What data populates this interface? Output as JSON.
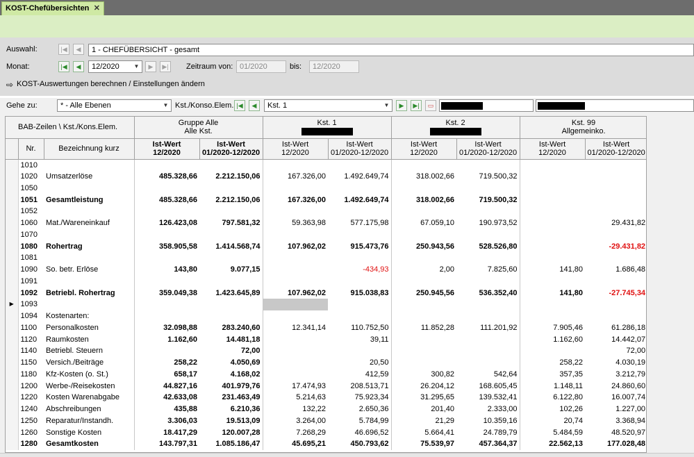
{
  "tab": {
    "title": "KOST-Chefübersichten",
    "close": "✕"
  },
  "auswahl": {
    "label": "Auswahl:",
    "value": "1 - CHEFÜBERSICHT - gesamt"
  },
  "monat": {
    "label": "Monat:",
    "value": "12/2020",
    "zeitraum_label": "Zeitraum von:",
    "from": "01/2020",
    "bis_label": "bis:",
    "to": "12/2020"
  },
  "calc_link": "KOST-Auswertungen berechnen / Einstellungen ändern",
  "goto": {
    "label": "Gehe zu:",
    "value": "* - Alle Ebenen",
    "kst_label": "Kst./Konso.Elem.:",
    "kst_value": "Kst. 1"
  },
  "colors": {
    "accent_green": "#cfe9a4",
    "negative": "#e01010"
  },
  "header": {
    "corner": "BAB-Zeilen  \\  Kst./Kons.Elem.",
    "nr": "Nr.",
    "bez": "Bezeichnung kurz",
    "groups": [
      {
        "line1": "Gruppe Alle",
        "line2": "Alle Kst."
      },
      {
        "line1": "Kst. 1",
        "line2": ""
      },
      {
        "line1": "Kst. 2",
        "line2": ""
      },
      {
        "line1": "Kst. 99",
        "line2": "Allgemeinko."
      }
    ],
    "sub1a": "Ist-Wert",
    "sub1b": "12/2020",
    "sub2a": "Ist-Wert",
    "sub2b": "01/2020-12/2020"
  },
  "rows": [
    {
      "nr": "1010",
      "bez": "",
      "b": false,
      "v": [
        "",
        "",
        "",
        "",
        "",
        "",
        "",
        ""
      ]
    },
    {
      "nr": "1020",
      "bez": "Umsatzerlöse",
      "b": false,
      "v": [
        "485.328,66",
        "2.212.150,06",
        "167.326,00",
        "1.492.649,74",
        "318.002,66",
        "719.500,32",
        "",
        ""
      ]
    },
    {
      "nr": "1050",
      "bez": "",
      "b": false,
      "v": [
        "",
        "",
        "",
        "",
        "",
        "",
        "",
        ""
      ]
    },
    {
      "nr": "1051",
      "bez": "Gesamtleistung",
      "b": true,
      "v": [
        "485.328,66",
        "2.212.150,06",
        "167.326,00",
        "1.492.649,74",
        "318.002,66",
        "719.500,32",
        "",
        ""
      ]
    },
    {
      "nr": "1052",
      "bez": "",
      "b": false,
      "v": [
        "",
        "",
        "",
        "",
        "",
        "",
        "",
        ""
      ]
    },
    {
      "nr": "1060",
      "bez": "Mat./Wareneinkauf",
      "b": false,
      "v": [
        "126.423,08",
        "797.581,32",
        "59.363,98",
        "577.175,98",
        "67.059,10",
        "190.973,52",
        "",
        "29.431,82"
      ]
    },
    {
      "nr": "1070",
      "bez": "",
      "b": false,
      "v": [
        "",
        "",
        "",
        "",
        "",
        "",
        "",
        ""
      ]
    },
    {
      "nr": "1080",
      "bez": "Rohertrag",
      "b": true,
      "v": [
        "358.905,58",
        "1.414.568,74",
        "107.962,02",
        "915.473,76",
        "250.943,56",
        "528.526,80",
        "",
        "-29.431,82"
      ]
    },
    {
      "nr": "1081",
      "bez": "",
      "b": false,
      "v": [
        "",
        "",
        "",
        "",
        "",
        "",
        "",
        ""
      ]
    },
    {
      "nr": "1090",
      "bez": "So. betr. Erlöse",
      "b": false,
      "v": [
        "143,80",
        "9.077,15",
        "",
        "-434,93",
        "2,00",
        "7.825,60",
        "141,80",
        "1.686,48"
      ]
    },
    {
      "nr": "1091",
      "bez": "",
      "b": false,
      "v": [
        "",
        "",
        "",
        "",
        "",
        "",
        "",
        ""
      ]
    },
    {
      "nr": "1092",
      "bez": "Betriebl. Rohertrag",
      "b": true,
      "v": [
        "359.049,38",
        "1.423.645,89",
        "107.962,02",
        "915.038,83",
        "250.945,56",
        "536.352,40",
        "141,80",
        "-27.745,34"
      ]
    },
    {
      "nr": "1093",
      "bez": "",
      "b": false,
      "v": [
        "",
        "",
        "",
        "",
        "",
        "",
        "",
        ""
      ]
    },
    {
      "nr": "1094",
      "bez": "Kostenarten:",
      "b": false,
      "v": [
        "",
        "",
        "",
        "",
        "",
        "",
        "",
        ""
      ]
    },
    {
      "nr": "1100",
      "bez": "Personalkosten",
      "b": false,
      "v": [
        "32.098,88",
        "283.240,60",
        "12.341,14",
        "110.752,50",
        "11.852,28",
        "111.201,92",
        "7.905,46",
        "61.286,18"
      ]
    },
    {
      "nr": "1120",
      "bez": "Raumkosten",
      "b": false,
      "v": [
        "1.162,60",
        "14.481,18",
        "",
        "39,11",
        "",
        "",
        "1.162,60",
        "14.442,07"
      ]
    },
    {
      "nr": "1140",
      "bez": "Betriebl. Steuern",
      "b": false,
      "v": [
        "",
        "72,00",
        "",
        "",
        "",
        "",
        "",
        "72,00"
      ]
    },
    {
      "nr": "1150",
      "bez": "Versich./Beiträge",
      "b": false,
      "v": [
        "258,22",
        "4.050,69",
        "",
        "20,50",
        "",
        "",
        "258,22",
        "4.030,19"
      ]
    },
    {
      "nr": "1180",
      "bez": "Kfz-Kosten (o. St.)",
      "b": false,
      "v": [
        "658,17",
        "4.168,02",
        "",
        "412,59",
        "300,82",
        "542,64",
        "357,35",
        "3.212,79"
      ]
    },
    {
      "nr": "1200",
      "bez": "Werbe-/Reisekosten",
      "b": false,
      "v": [
        "44.827,16",
        "401.979,76",
        "17.474,93",
        "208.513,71",
        "26.204,12",
        "168.605,45",
        "1.148,11",
        "24.860,60"
      ]
    },
    {
      "nr": "1220",
      "bez": "Kosten Warenabgabe",
      "b": false,
      "v": [
        "42.633,08",
        "231.463,49",
        "5.214,63",
        "75.923,34",
        "31.295,65",
        "139.532,41",
        "6.122,80",
        "16.007,74"
      ]
    },
    {
      "nr": "1240",
      "bez": "Abschreibungen",
      "b": false,
      "v": [
        "435,88",
        "6.210,36",
        "132,22",
        "2.650,36",
        "201,40",
        "2.333,00",
        "102,26",
        "1.227,00"
      ]
    },
    {
      "nr": "1250",
      "bez": "Reparatur/Instandh.",
      "b": false,
      "v": [
        "3.306,03",
        "19.513,09",
        "3.264,00",
        "5.784,99",
        "21,29",
        "10.359,16",
        "20,74",
        "3.368,94"
      ]
    },
    {
      "nr": "1260",
      "bez": "Sonstige Kosten",
      "b": false,
      "v": [
        "18.417,29",
        "120.007,28",
        "7.268,29",
        "46.696,52",
        "5.664,41",
        "24.789,79",
        "5.484,59",
        "48.520,97"
      ]
    },
    {
      "nr": "1280",
      "bez": "Gesamtkosten",
      "b": true,
      "v": [
        "143.797,31",
        "1.085.186,47",
        "45.695,21",
        "450.793,62",
        "75.539,97",
        "457.364,37",
        "22.562,13",
        "177.028,48"
      ]
    }
  ]
}
